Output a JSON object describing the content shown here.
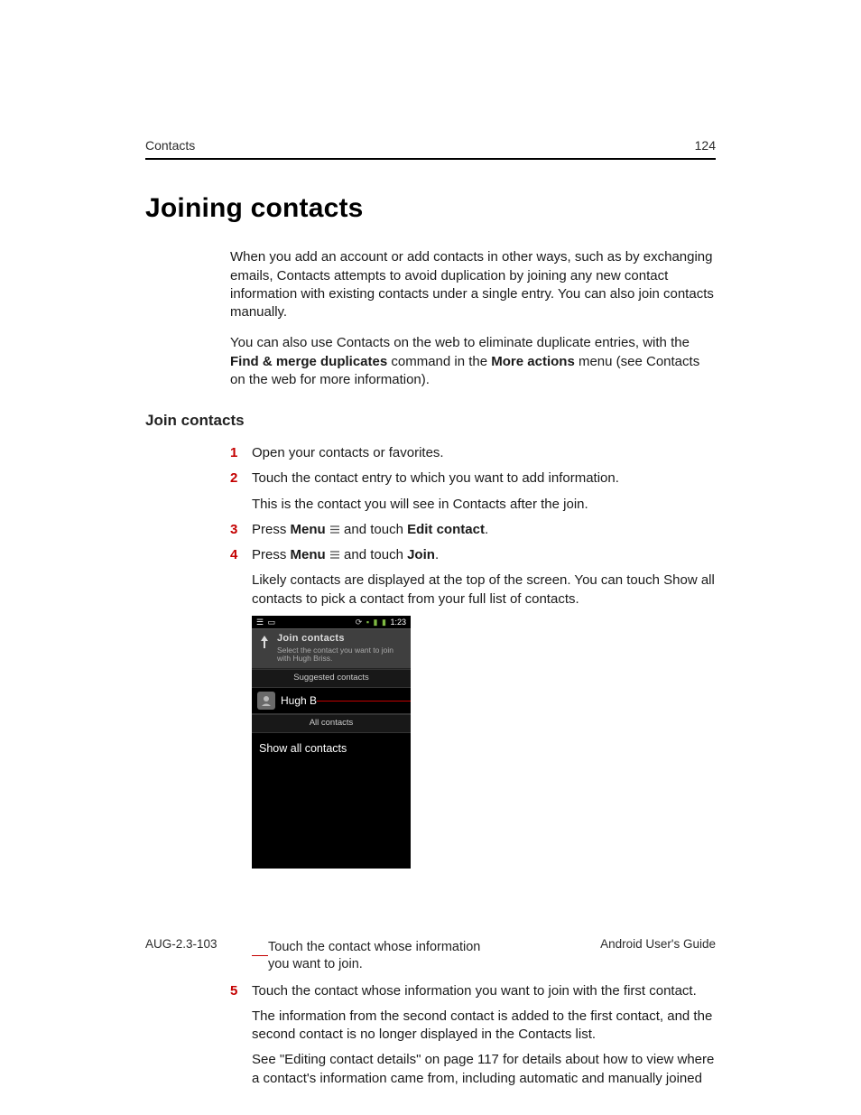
{
  "header": {
    "section": "Contacts",
    "page": "124"
  },
  "h1": "Joining contacts",
  "intro": {
    "p1": "When you add an account or add contacts in other ways, such as by exchanging emails, Contacts attempts to avoid duplication by joining any new contact information with existing contacts under a single entry. You can also join contacts manually.",
    "p2a": "You can also use Contacts on the web to eliminate duplicate entries, with the ",
    "p2b": "Find & merge duplicates",
    "p2c": " command in the ",
    "p2d": "More actions",
    "p2e": " menu (see Contacts on the web for more information)."
  },
  "h2": "Join contacts",
  "steps": {
    "s1": "Open your contacts or favorites.",
    "s2": "Touch the contact entry to which you want to add information.",
    "s2sub": "This is the contact you will see in Contacts after the join.",
    "s3a": "Press ",
    "s3menu": "Menu",
    "s3b": " and touch ",
    "s3edit": "Edit contact",
    "s3c": ".",
    "s4a": "Press ",
    "s4menu": "Menu",
    "s4b": " and touch ",
    "s4join": "Join",
    "s4c": ".",
    "s4sub": "Likely contacts are displayed at the top of the screen. You can touch Show all contacts to pick a contact from your full list of contacts.",
    "s5": "Touch the contact whose information you want to join with the first contact.",
    "s5sub1": "The information from the second contact is added to the first contact, and the second contact is no longer displayed in the Contacts list.",
    "s5sub2": "See \"Editing contact details\" on page 117 for details about how to view where a contact's information came from, including automatic and manually joined"
  },
  "phone": {
    "time": "1:23",
    "title": "Join contacts",
    "subtitle": "Select the contact you want to join with Hugh Briss.",
    "suggested": "Suggested contacts",
    "contactName": "Hugh B",
    "allContacts": "All contacts",
    "showAll": "Show all contacts"
  },
  "callout": "Touch the contact whose information you want to join.",
  "footer": {
    "left": "AUG-2.3-103",
    "right": "Android User's Guide"
  },
  "nums": {
    "n1": "1",
    "n2": "2",
    "n3": "3",
    "n4": "4",
    "n5": "5"
  }
}
